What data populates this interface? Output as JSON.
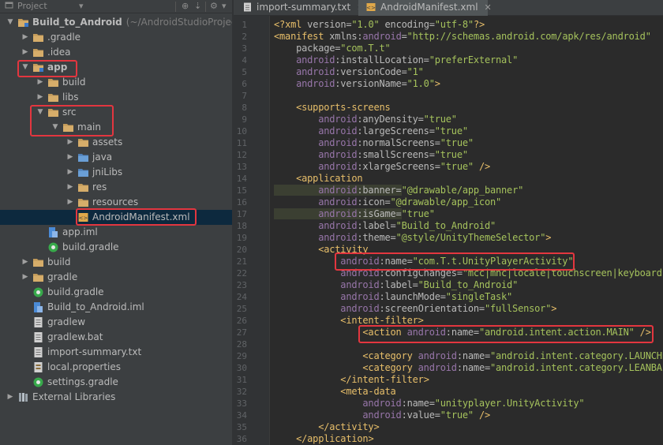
{
  "project_panel": {
    "toolbar": {
      "title": "Project"
    },
    "tree": [
      {
        "label": "Build_to_Android",
        "suffix": "(~/AndroidStudioProject",
        "icon": "module-folder-icon",
        "indent": 0,
        "expanded": true,
        "bold": true
      },
      {
        "label": ".gradle",
        "icon": "folder-icon",
        "indent": 1,
        "expanded": false
      },
      {
        "label": ".idea",
        "icon": "folder-icon",
        "indent": 1,
        "expanded": false
      },
      {
        "label": "app",
        "icon": "module-folder-icon",
        "indent": 1,
        "expanded": true,
        "bold": true,
        "highlight": true
      },
      {
        "label": "build",
        "icon": "folder-icon",
        "indent": 2,
        "expanded": false
      },
      {
        "label": "libs",
        "icon": "folder-icon",
        "indent": 2,
        "expanded": false
      },
      {
        "label": "src",
        "icon": "folder-icon",
        "indent": 2,
        "expanded": true,
        "highlight_group": true
      },
      {
        "label": "main",
        "icon": "folder-icon",
        "indent": 3,
        "expanded": true,
        "highlight_group": true
      },
      {
        "label": "assets",
        "icon": "folder-icon",
        "indent": 4,
        "expanded": false
      },
      {
        "label": "java",
        "icon": "source-folder-icon",
        "indent": 4,
        "expanded": false
      },
      {
        "label": "jniLibs",
        "icon": "source-folder-icon",
        "indent": 4,
        "expanded": false
      },
      {
        "label": "res",
        "icon": "folder-icon",
        "indent": 4,
        "expanded": false
      },
      {
        "label": "resources",
        "icon": "folder-icon",
        "indent": 4,
        "expanded": false
      },
      {
        "label": "AndroidManifest.xml",
        "icon": "xml-file-icon",
        "indent": 4,
        "leaf": true,
        "selected": true,
        "highlight": true
      },
      {
        "label": "app.iml",
        "icon": "iml-file-icon",
        "indent": 2,
        "leaf": true
      },
      {
        "label": "build.gradle",
        "icon": "gradle-file-icon",
        "indent": 2,
        "leaf": true
      },
      {
        "label": "build",
        "icon": "folder-icon",
        "indent": 1,
        "expanded": false
      },
      {
        "label": "gradle",
        "icon": "folder-icon",
        "indent": 1,
        "expanded": false
      },
      {
        "label": "build.gradle",
        "icon": "gradle-file-icon",
        "indent": 1,
        "leaf": true
      },
      {
        "label": "Build_to_Android.iml",
        "icon": "iml-file-icon",
        "indent": 1,
        "leaf": true
      },
      {
        "label": "gradlew",
        "icon": "text-file-icon",
        "indent": 1,
        "leaf": true
      },
      {
        "label": "gradlew.bat",
        "icon": "text-file-icon",
        "indent": 1,
        "leaf": true
      },
      {
        "label": "import-summary.txt",
        "icon": "text-file-icon",
        "indent": 1,
        "leaf": true
      },
      {
        "label": "local.properties",
        "icon": "properties-file-icon",
        "indent": 1,
        "leaf": true
      },
      {
        "label": "settings.gradle",
        "icon": "gradle-file-icon",
        "indent": 1,
        "leaf": true
      },
      {
        "label": "External Libraries",
        "icon": "libraries-icon",
        "indent": 0,
        "expanded": false
      }
    ]
  },
  "editor": {
    "tabs": [
      {
        "label": "import-summary.txt",
        "icon": "text-file-icon",
        "active": false
      },
      {
        "label": "AndroidManifest.xml",
        "icon": "xml-file-icon",
        "active": true
      }
    ],
    "lines": [
      {
        "n": "1",
        "parts": [
          [
            "punct",
            "<?"
          ],
          [
            "tag",
            "xml "
          ],
          [
            "attr",
            "version="
          ],
          [
            "val",
            "\"1.0\" "
          ],
          [
            "attr",
            "encoding="
          ],
          [
            "val",
            "\"utf-8\""
          ],
          [
            "punct",
            "?>"
          ]
        ]
      },
      {
        "n": "2",
        "parts": [
          [
            "punct",
            "<"
          ],
          [
            "tag",
            "manifest "
          ],
          [
            "attr",
            "xmlns:"
          ],
          [
            "ns",
            "android"
          ],
          [
            "attr",
            "="
          ],
          [
            "val",
            "\"http://schemas.android.com/apk/res/android\""
          ]
        ]
      },
      {
        "n": "3",
        "parts": [
          [
            "attr",
            "    package="
          ],
          [
            "val",
            "\"com.T.t\""
          ]
        ]
      },
      {
        "n": "4",
        "parts": [
          [
            "ns",
            "    android"
          ],
          [
            "attr",
            ":installLocation="
          ],
          [
            "val",
            "\"preferExternal\""
          ]
        ]
      },
      {
        "n": "5",
        "parts": [
          [
            "ns",
            "    android"
          ],
          [
            "attr",
            ":versionCode="
          ],
          [
            "val",
            "\"1\""
          ]
        ]
      },
      {
        "n": "6",
        "parts": [
          [
            "ns",
            "    android"
          ],
          [
            "attr",
            ":versionName="
          ],
          [
            "val",
            "\"1.0\""
          ],
          [
            "punct",
            ">"
          ]
        ]
      },
      {
        "n": "7",
        "parts": []
      },
      {
        "n": "8",
        "parts": [
          [
            "punct",
            "    <"
          ],
          [
            "tag",
            "supports-screens"
          ]
        ]
      },
      {
        "n": "9",
        "parts": [
          [
            "ns",
            "        android"
          ],
          [
            "attr",
            ":anyDensity="
          ],
          [
            "val",
            "\"true\""
          ]
        ]
      },
      {
        "n": "10",
        "parts": [
          [
            "ns",
            "        android"
          ],
          [
            "attr",
            ":largeScreens="
          ],
          [
            "val",
            "\"true\""
          ]
        ]
      },
      {
        "n": "11",
        "parts": [
          [
            "ns",
            "        android"
          ],
          [
            "attr",
            ":normalScreens="
          ],
          [
            "val",
            "\"true\""
          ]
        ]
      },
      {
        "n": "12",
        "parts": [
          [
            "ns",
            "        android"
          ],
          [
            "attr",
            ":smallScreens="
          ],
          [
            "val",
            "\"true\""
          ]
        ]
      },
      {
        "n": "13",
        "parts": [
          [
            "ns",
            "        android"
          ],
          [
            "attr",
            ":xlargeScreens="
          ],
          [
            "val",
            "\"true\" "
          ],
          [
            "punct",
            "/>"
          ]
        ]
      },
      {
        "n": "14",
        "parts": [
          [
            "punct",
            "    <"
          ],
          [
            "tag",
            "application"
          ]
        ]
      },
      {
        "n": "15",
        "parts": [
          [
            "ns",
            "        android"
          ],
          [
            "attr",
            ":banner="
          ],
          [
            "val",
            "\"@drawable/app_banner\""
          ]
        ],
        "shade": true
      },
      {
        "n": "16",
        "parts": [
          [
            "ns",
            "        android"
          ],
          [
            "attr",
            ":icon="
          ],
          [
            "val",
            "\"@drawable/app_icon\""
          ]
        ]
      },
      {
        "n": "17",
        "parts": [
          [
            "ns",
            "        android"
          ],
          [
            "attr",
            ":isGame="
          ],
          [
            "val",
            "\"true\""
          ]
        ],
        "shade": true
      },
      {
        "n": "18",
        "parts": [
          [
            "ns",
            "        android"
          ],
          [
            "attr",
            ":label="
          ],
          [
            "val",
            "\"Build_to_Android\""
          ]
        ]
      },
      {
        "n": "19",
        "parts": [
          [
            "ns",
            "        android"
          ],
          [
            "attr",
            ":theme="
          ],
          [
            "val",
            "\"@style/UnityThemeSelector\""
          ],
          [
            "punct",
            ">"
          ]
        ]
      },
      {
        "n": "20",
        "parts": [
          [
            "punct",
            "        <"
          ],
          [
            "tag",
            "activity"
          ]
        ]
      },
      {
        "n": "21",
        "parts": [
          [
            "ns",
            "            android"
          ],
          [
            "attr",
            ":name="
          ],
          [
            "val",
            "\"com.T.t.UnityPlayerActivity\""
          ]
        ],
        "highlight": true
      },
      {
        "n": "22",
        "parts": [
          [
            "ns",
            "            android"
          ],
          [
            "attr",
            ":configChanges="
          ],
          [
            "val",
            "\"mcc|mnc|locale|touchscreen|keyboard"
          ]
        ]
      },
      {
        "n": "23",
        "parts": [
          [
            "ns",
            "            android"
          ],
          [
            "attr",
            ":label="
          ],
          [
            "val",
            "\"Build_to_Android\""
          ]
        ]
      },
      {
        "n": "24",
        "parts": [
          [
            "ns",
            "            android"
          ],
          [
            "attr",
            ":launchMode="
          ],
          [
            "val",
            "\"singleTask\""
          ]
        ]
      },
      {
        "n": "25",
        "parts": [
          [
            "ns",
            "            android"
          ],
          [
            "attr",
            ":screenOrientation="
          ],
          [
            "val",
            "\"fullSensor\""
          ],
          [
            "punct",
            ">"
          ]
        ]
      },
      {
        "n": "26",
        "parts": [
          [
            "punct",
            "            <"
          ],
          [
            "tag",
            "intent-filter"
          ],
          [
            "punct",
            ">"
          ]
        ]
      },
      {
        "n": "27",
        "parts": [
          [
            "punct",
            "                <"
          ],
          [
            "tag",
            "action "
          ],
          [
            "ns",
            "android"
          ],
          [
            "attr",
            ":name="
          ],
          [
            "val",
            "\"android.intent.action.MAIN\" "
          ],
          [
            "punct",
            "/>"
          ]
        ],
        "highlight": true
      },
      {
        "n": "28",
        "parts": []
      },
      {
        "n": "29",
        "parts": [
          [
            "punct",
            "                <"
          ],
          [
            "tag",
            "category "
          ],
          [
            "ns",
            "android"
          ],
          [
            "attr",
            ":name="
          ],
          [
            "val",
            "\"android.intent.category.LAUNCHE"
          ]
        ]
      },
      {
        "n": "30",
        "parts": [
          [
            "punct",
            "                <"
          ],
          [
            "tag",
            "category "
          ],
          [
            "ns",
            "android"
          ],
          [
            "attr",
            ":name="
          ],
          [
            "val",
            "\"android.intent.category.LEANBA"
          ]
        ]
      },
      {
        "n": "31",
        "parts": [
          [
            "punct",
            "            </"
          ],
          [
            "tag",
            "intent-filter"
          ],
          [
            "punct",
            ">"
          ]
        ]
      },
      {
        "n": "32",
        "parts": [
          [
            "punct",
            "            <"
          ],
          [
            "tag",
            "meta-data"
          ]
        ]
      },
      {
        "n": "33",
        "parts": [
          [
            "ns",
            "                android"
          ],
          [
            "attr",
            ":name="
          ],
          [
            "val",
            "\"unityplayer.UnityActivity\""
          ]
        ]
      },
      {
        "n": "34",
        "parts": [
          [
            "ns",
            "                android"
          ],
          [
            "attr",
            ":value="
          ],
          [
            "val",
            "\"true\" "
          ],
          [
            "punct",
            "/>"
          ]
        ]
      },
      {
        "n": "35",
        "parts": [
          [
            "punct",
            "        </"
          ],
          [
            "tag",
            "activity"
          ],
          [
            "punct",
            ">"
          ]
        ]
      },
      {
        "n": "36",
        "parts": [
          [
            "punct",
            "    </"
          ],
          [
            "tag",
            "application"
          ],
          [
            "punct",
            ">"
          ]
        ]
      }
    ]
  },
  "colors": {
    "panel_bg": "#3c3f41",
    "editor_bg": "#2b2b2b",
    "highlight_border": "#e3363f",
    "folder": "#c29a5a",
    "source_folder": "#6a9fd6",
    "selection": "#0d293e"
  }
}
